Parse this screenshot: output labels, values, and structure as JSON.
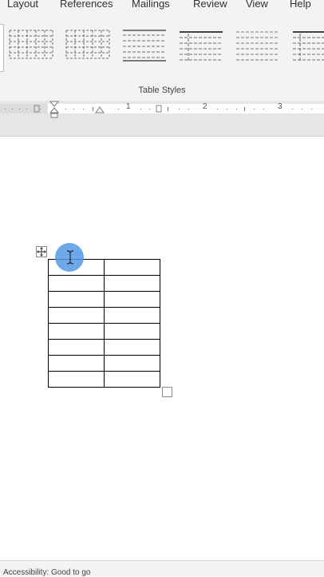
{
  "ribbon": {
    "tabs": [
      {
        "label": "Layout"
      },
      {
        "label": "References"
      },
      {
        "label": "Mailings"
      },
      {
        "label": "Review"
      },
      {
        "label": "View"
      },
      {
        "label": "Help"
      }
    ],
    "group_label": "Table Styles",
    "table_styles": [
      {
        "style": "grid-dashed"
      },
      {
        "style": "grid-dashed"
      },
      {
        "style": "lines-header"
      },
      {
        "style": "lines-dark-header"
      },
      {
        "style": "lines-light"
      },
      {
        "style": "lines-partial"
      }
    ]
  },
  "ruler": {
    "numbers": [
      "1",
      "2",
      "3"
    ]
  },
  "document": {
    "table": {
      "rows": 8,
      "cols": 2
    }
  },
  "status_bar": {
    "text": "Accessibility: Good to go"
  },
  "colors": {
    "ribbon_bg": "#f3f3f3",
    "ruler_bg": "#e6e6e6",
    "cursor_highlight": "#5499e6"
  },
  "icons": {
    "table_move": "four-way-arrow-icon",
    "table_resize": "resize-handle-icon",
    "cursor": "text-ibeam-cursor-icon"
  }
}
